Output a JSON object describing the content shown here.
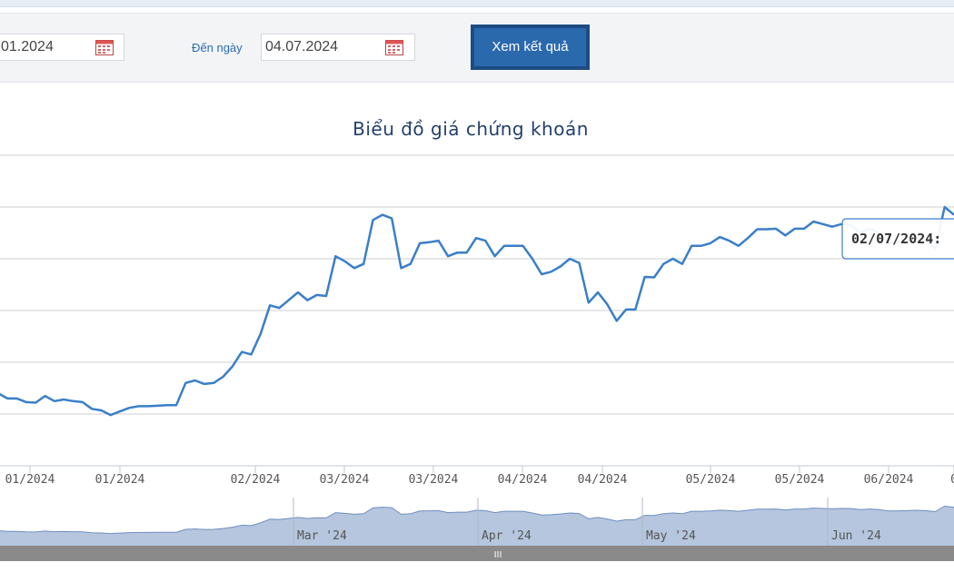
{
  "filter": {
    "from_value": "01.2024",
    "to_label": "Đến ngày",
    "to_value": "04.07.2024",
    "submit_label": "Xem kết quả"
  },
  "colors": {
    "line": "#3a7fc8",
    "navigator_fill": "#b5c6de",
    "button": "#2b69ad",
    "title": "#23406e"
  },
  "tooltip": {
    "text": "02/07/2024:"
  },
  "chart_data": {
    "type": "line",
    "title": "Biểu đồ giá chứng khoán",
    "grid": true,
    "xlabels": [
      "01/2024",
      "01/2024",
      "02/2024",
      "03/2024",
      "03/2024",
      "04/2024",
      "04/2024",
      "05/2024",
      "05/2024",
      "06/2024",
      "0"
    ],
    "navigator_labels": [
      "Mar '24",
      "Apr '24",
      "May '24",
      "Jun '24"
    ],
    "scrollbar_handle": "III",
    "ylim": [
      0,
      6
    ],
    "values": [
      1.4,
      1.3,
      1.3,
      1.23,
      1.22,
      1.35,
      1.25,
      1.28,
      1.25,
      1.23,
      1.1,
      1.07,
      0.98,
      1.05,
      1.12,
      1.15,
      1.15,
      1.16,
      1.17,
      1.17,
      1.6,
      1.65,
      1.58,
      1.6,
      1.72,
      1.92,
      2.2,
      2.15,
      2.55,
      3.1,
      3.05,
      3.2,
      3.35,
      3.2,
      3.3,
      3.28,
      4.05,
      3.95,
      3.82,
      3.9,
      4.75,
      4.85,
      4.78,
      3.82,
      3.9,
      4.3,
      4.32,
      4.35,
      4.05,
      4.12,
      4.12,
      4.4,
      4.35,
      4.05,
      4.25,
      4.25,
      4.25,
      4.0,
      3.7,
      3.75,
      3.85,
      4.0,
      3.92,
      3.15,
      3.35,
      3.12,
      2.8,
      3.02,
      3.02,
      3.65,
      3.64,
      3.9,
      4.0,
      3.9,
      4.25,
      4.25,
      4.3,
      4.42,
      4.35,
      4.25,
      4.4,
      4.57,
      4.57,
      4.58,
      4.45,
      4.58,
      4.58,
      4.72,
      4.67,
      4.62,
      4.67,
      4.65,
      4.5,
      4.58,
      4.5,
      4.3,
      4.32,
      4.35,
      4.4,
      4.35,
      4.2,
      5.0,
      4.85
    ]
  }
}
